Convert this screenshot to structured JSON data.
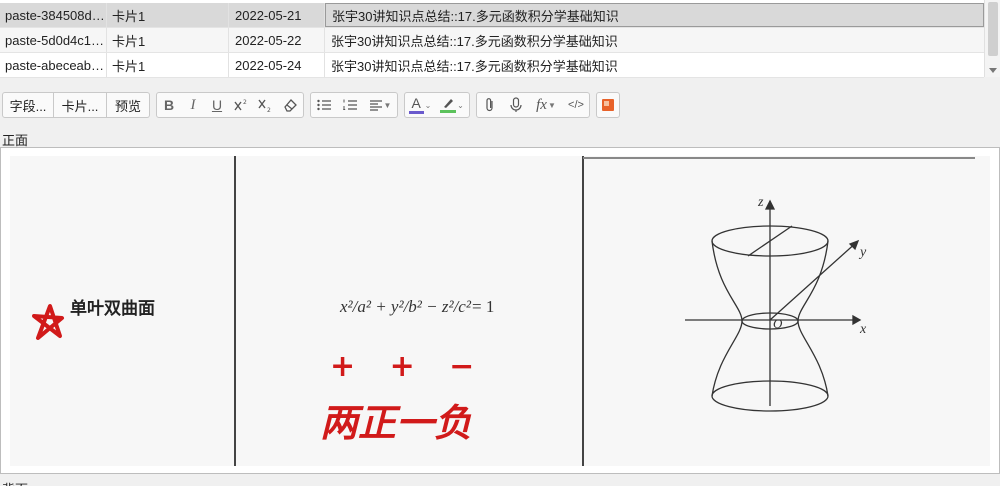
{
  "cards": {
    "rows": [
      {
        "sort_field": "paste-384508d…",
        "card": "卡片1",
        "due": "2022-05-21",
        "deck": "张宇30讲知识点总结::17.多元函数积分学基础知识",
        "selected": true
      },
      {
        "sort_field": "paste-5d0d4c1…",
        "card": "卡片1",
        "due": "2022-05-22",
        "deck": "张宇30讲知识点总结::17.多元函数积分学基础知识",
        "selected": false
      },
      {
        "sort_field": "paste-abeceab…",
        "card": "卡片1",
        "due": "2022-05-24",
        "deck": "张宇30讲知识点总结::17.多元函数积分学基础知识",
        "selected": false
      }
    ]
  },
  "toolbar": {
    "fields_label": "字段...",
    "cards_label": "卡片...",
    "preview_label": "预览",
    "bold_glyph": "B",
    "italic_glyph": "I",
    "underline_glyph": "U",
    "text_color_glyph": "A",
    "function_glyph": "fx",
    "html_glyph": "</>",
    "text_color": "#6a5acd",
    "highlight_color": "#5cc25c",
    "image_occlusion_color": "#e8622a"
  },
  "editor": {
    "front_label": "正面",
    "back_label": "背面"
  },
  "note_image": {
    "left_note": "单叶双曲面",
    "equation_lhs": "x²/a² + y²/b² − z²/c²",
    "equation_rhs": "= 1",
    "signs": "+ + −",
    "handwritten": "两正一负",
    "axis_x": "x",
    "axis_y": "y",
    "axis_z": "z",
    "origin": "O",
    "ink_color": "#d11a1a"
  }
}
